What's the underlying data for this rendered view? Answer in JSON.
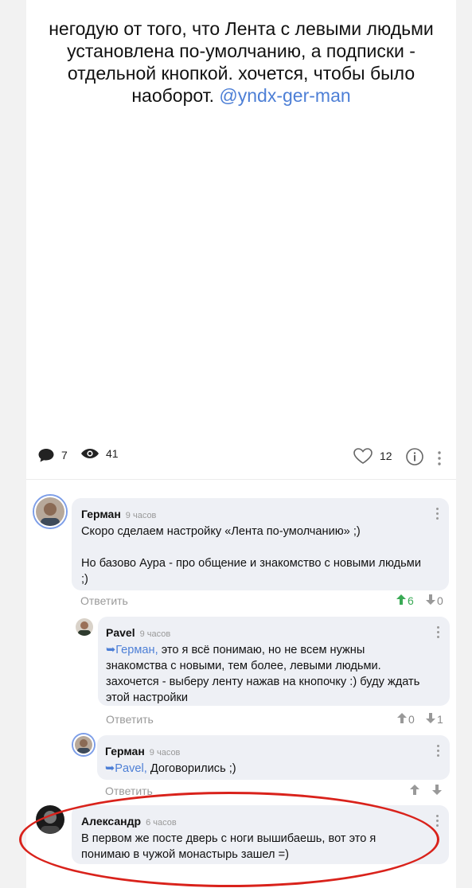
{
  "post": {
    "text": "негодую от того, что Лента с левыми людьми установлена по-умолчанию, а подписки - отдельной кнопкой. хочется, чтобы было наоборот.",
    "mention": "@yndx-ger-man"
  },
  "stats": {
    "comments_count": "7",
    "views_count": "41",
    "likes_count": "12"
  },
  "icons": {
    "comment": "comment-icon",
    "eye": "eye-icon",
    "heart": "heart-icon",
    "info": "info-icon",
    "more": "more-vertical-icon"
  },
  "colors": {
    "accent": "#4d7fd6",
    "upvote": "#3aaa55",
    "bubble": "#eef0f5",
    "highlight": "#d9221b"
  },
  "comments": [
    {
      "author": "Герман",
      "time": "9 часов",
      "lines": [
        "Скоро сделаем настройку «Лента по-умолчанию» ;)",
        "",
        "Но базово Аура - про общение и знакомство с новыми людьми ;)"
      ],
      "reply_label": "Ответить",
      "up": "6",
      "down": "0"
    },
    {
      "author": "Pavel",
      "time": "9 часов",
      "reply_to": "➥Герман,",
      "text": " это я всё понимаю, но не всем нужны знакомства с новыми, тем более, левыми людьми. захочется - выберу ленту нажав на кнопочку :) буду ждать этой настройки",
      "reply_label": "Ответить",
      "up": "0",
      "down": "1"
    },
    {
      "author": "Герман",
      "time": "9 часов",
      "reply_to": "➥Pavel,",
      "text": " Договорились ;)",
      "reply_label": "Ответить"
    },
    {
      "author": "Александр",
      "time": "6 часов",
      "text": "В первом же посте дверь с ноги вышибаешь, вот это я понимаю в чужой монастырь зашел =)"
    }
  ]
}
